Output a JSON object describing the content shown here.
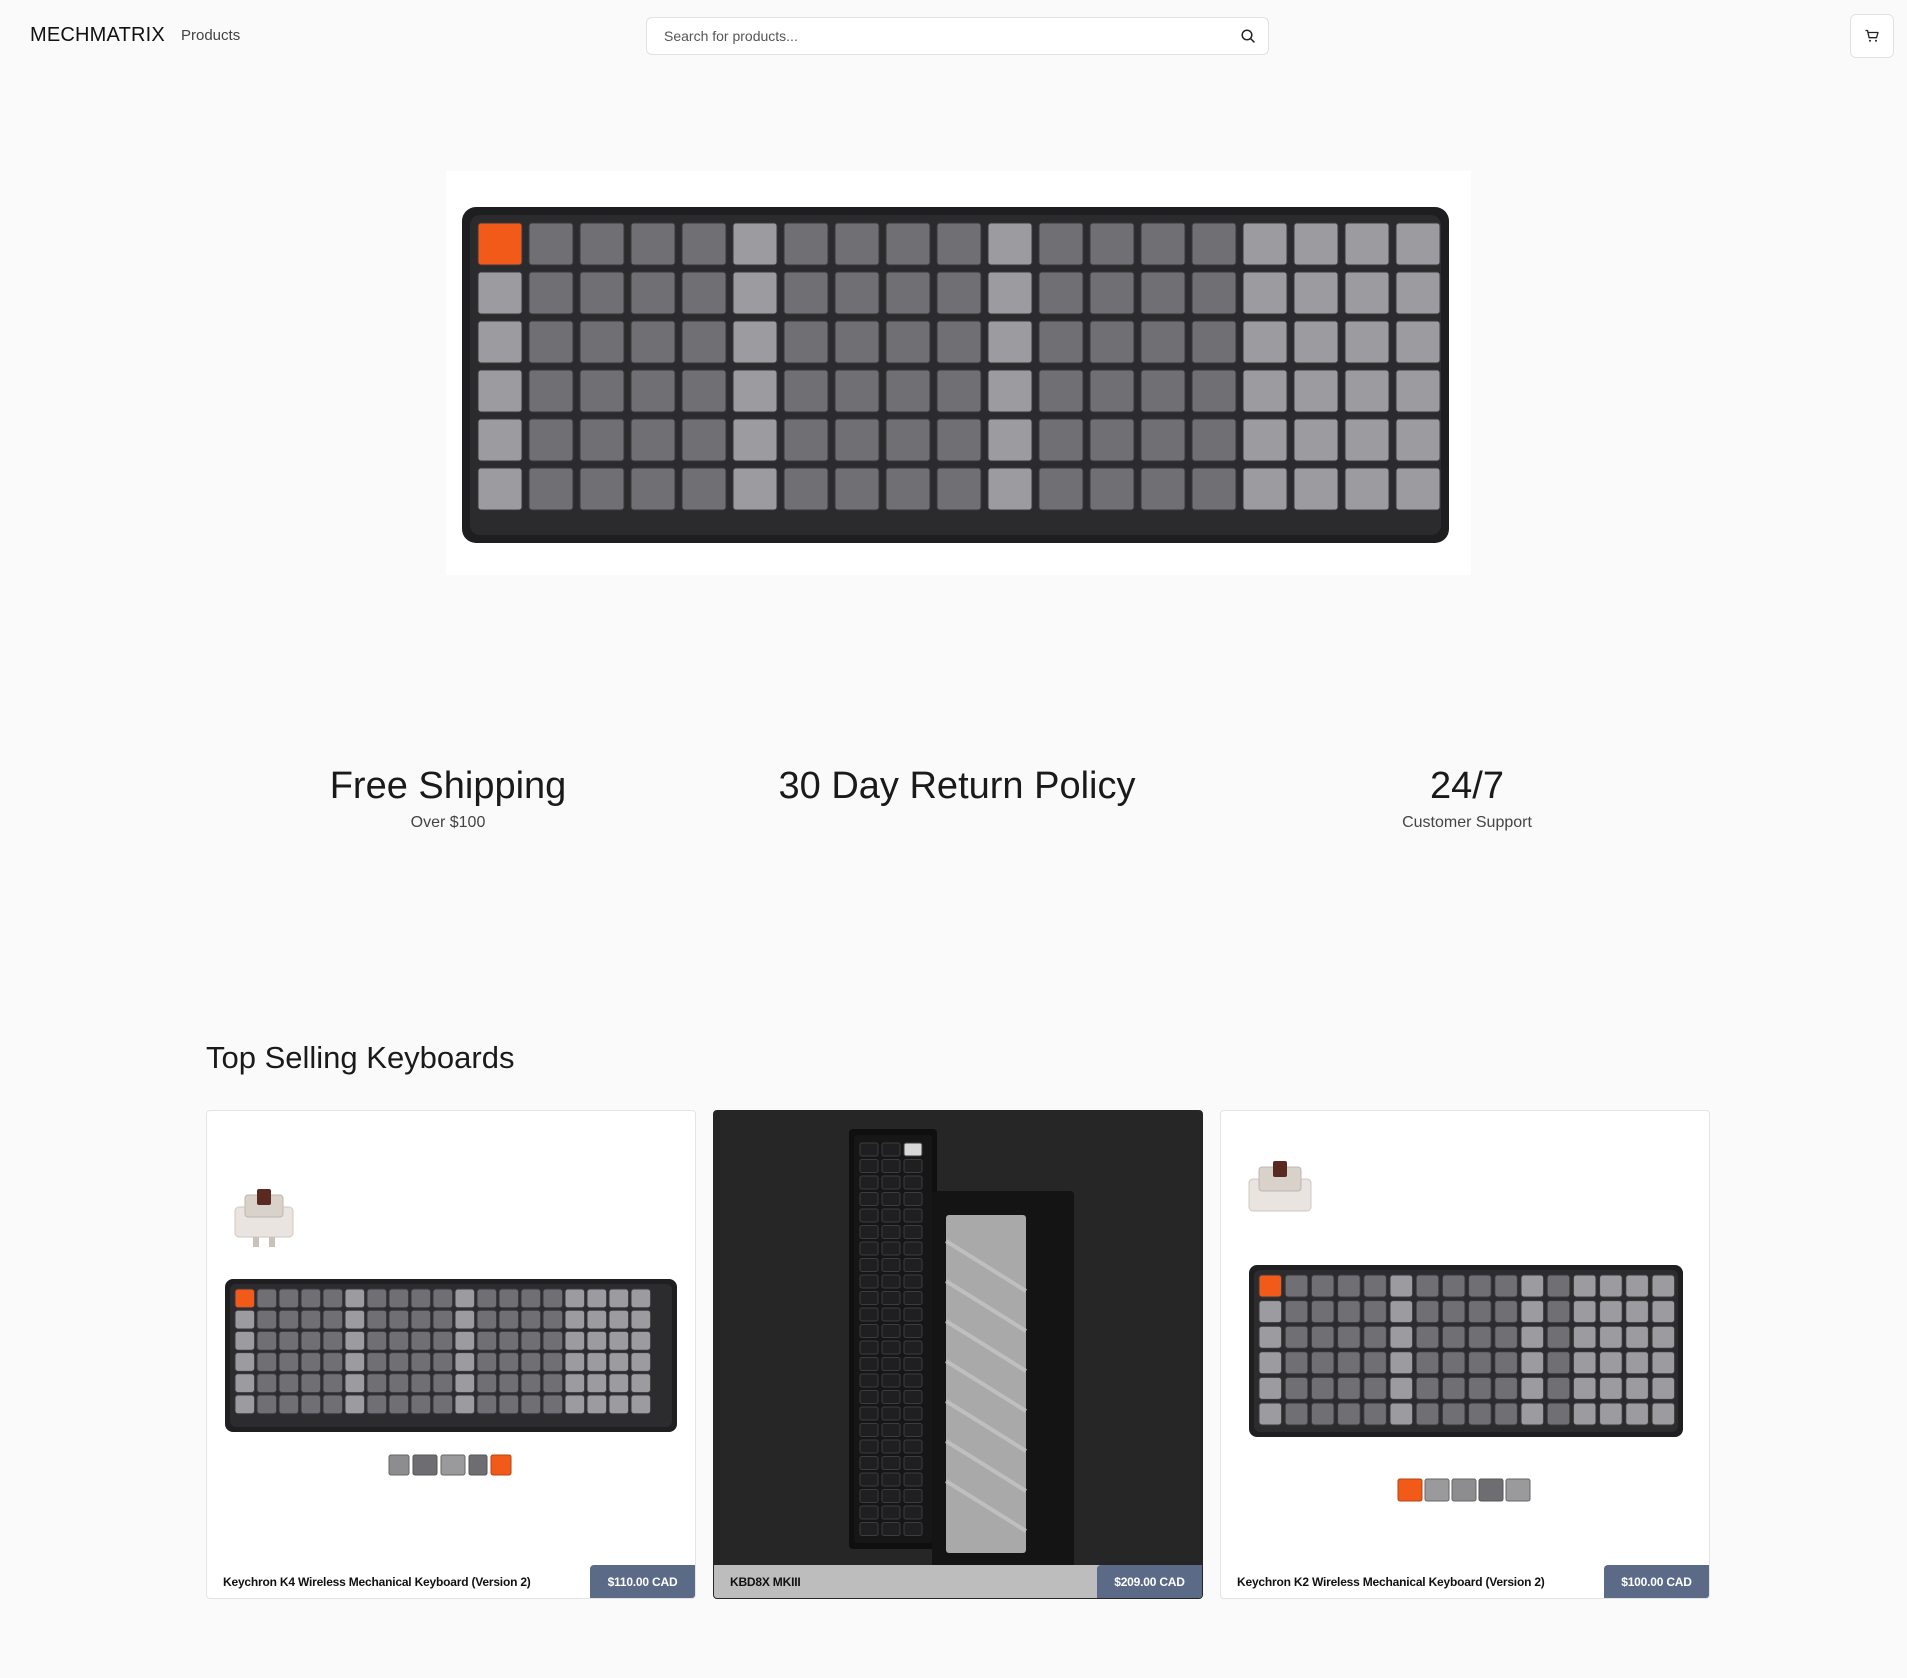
{
  "header": {
    "logo": "MECHMATRIX",
    "nav_products": "Products",
    "search_placeholder": "Search for products...",
    "search_icon": "search-icon",
    "cart_icon": "cart-icon"
  },
  "hero": {
    "image": "keyboard-hero-image"
  },
  "features": [
    {
      "title": "Free Shipping",
      "subtitle": "Over $100"
    },
    {
      "title": "30 Day Return Policy",
      "subtitle": ""
    },
    {
      "title": "24/7",
      "subtitle": "Customer Support"
    }
  ],
  "top_selling": {
    "title": "Top Selling Keyboards",
    "products": [
      {
        "name": "Keychron K4 Wireless Mechanical Keyboard (Version 2)",
        "price": "$110.00 CAD"
      },
      {
        "name": "KBD8X MKIII",
        "price": "$209.00 CAD"
      },
      {
        "name": "Keychron K2 Wireless Mechanical Keyboard (Version 2)",
        "price": "$100.00 CAD"
      }
    ]
  },
  "colors": {
    "accent_orange": "#f25a1a",
    "price_badge": "#5b6a87",
    "background": "#fafafa"
  }
}
